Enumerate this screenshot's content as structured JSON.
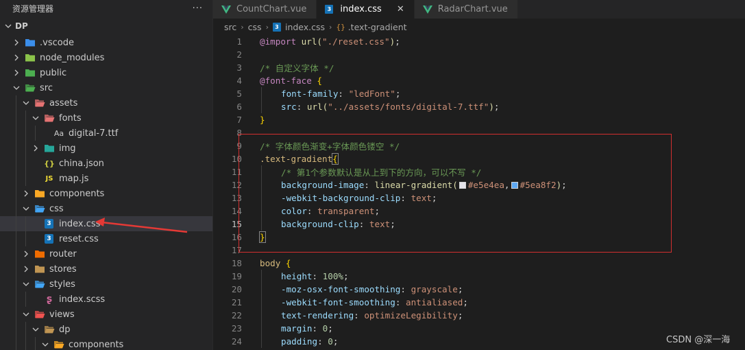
{
  "sidebar": {
    "title": "资源管理器",
    "more": "···",
    "root": "DP",
    "items": [
      {
        "label": ".vscode",
        "depth": 1,
        "kind": "folder",
        "icon": "vscode-folder-icon",
        "color": "#3b8eea",
        "open": false
      },
      {
        "label": "node_modules",
        "depth": 1,
        "kind": "folder",
        "icon": "node-folder-icon",
        "color": "#8bc34a",
        "open": false
      },
      {
        "label": "public",
        "depth": 1,
        "kind": "folder",
        "icon": "public-folder-icon",
        "color": "#4caf50",
        "open": false
      },
      {
        "label": "src",
        "depth": 1,
        "kind": "folder",
        "icon": "src-folder-icon",
        "color": "#4caf50",
        "open": true
      },
      {
        "label": "assets",
        "depth": 2,
        "kind": "folder",
        "icon": "assets-folder-icon",
        "color": "#e57373",
        "open": true
      },
      {
        "label": "fonts",
        "depth": 3,
        "kind": "folder",
        "icon": "fonts-folder-icon",
        "color": "#e57373",
        "open": true
      },
      {
        "label": "digital-7.ttf",
        "depth": 4,
        "kind": "font",
        "icon": "font-file-icon",
        "glyph": "Aa"
      },
      {
        "label": "img",
        "depth": 3,
        "kind": "folder",
        "icon": "img-folder-icon",
        "color": "#26a69a",
        "open": false
      },
      {
        "label": "china.json",
        "depth": 3,
        "kind": "json",
        "icon": "json-file-icon",
        "glyph": "{}"
      },
      {
        "label": "map.js",
        "depth": 3,
        "kind": "js",
        "icon": "js-file-icon",
        "glyph": "JS"
      },
      {
        "label": "components",
        "depth": 2,
        "kind": "folder",
        "icon": "components-folder-icon",
        "color": "#f9a825",
        "open": false
      },
      {
        "label": "css",
        "depth": 2,
        "kind": "folder",
        "icon": "css-folder-icon",
        "color": "#42a5f5",
        "open": true
      },
      {
        "label": "index.css",
        "depth": 3,
        "kind": "css",
        "icon": "css-file-icon",
        "glyph": "3",
        "selected": true
      },
      {
        "label": "reset.css",
        "depth": 3,
        "kind": "css",
        "icon": "css-file-icon",
        "glyph": "3"
      },
      {
        "label": "router",
        "depth": 2,
        "kind": "folder",
        "icon": "router-folder-icon",
        "color": "#ef6c00",
        "open": false
      },
      {
        "label": "stores",
        "depth": 2,
        "kind": "folder",
        "icon": "stores-folder-icon",
        "color": "#c09553",
        "open": false
      },
      {
        "label": "styles",
        "depth": 2,
        "kind": "folder",
        "icon": "styles-folder-icon",
        "color": "#42a5f5",
        "open": true
      },
      {
        "label": "index.scss",
        "depth": 3,
        "kind": "scss",
        "icon": "scss-file-icon",
        "glyph": "ʂ"
      },
      {
        "label": "views",
        "depth": 2,
        "kind": "folder",
        "icon": "views-folder-icon",
        "color": "#ef5350",
        "open": true
      },
      {
        "label": "dp",
        "depth": 3,
        "kind": "folder",
        "icon": "dp-folder-icon",
        "color": "#c09553",
        "open": true
      },
      {
        "label": "components",
        "depth": 4,
        "kind": "folder",
        "icon": "components-folder-icon",
        "color": "#f9a825",
        "open": true
      }
    ]
  },
  "tabs": [
    {
      "label": "CountChart.vue",
      "kind": "vue",
      "active": false
    },
    {
      "label": "index.css",
      "kind": "css",
      "active": true,
      "close": "✕"
    },
    {
      "label": "RadarChart.vue",
      "kind": "vue",
      "active": false
    }
  ],
  "breadcrumb": {
    "parts": [
      "src",
      "css",
      "index.css",
      ".text-gradient"
    ],
    "sep": "›",
    "css_glyph": "3",
    "symbol_glyph": "{}"
  },
  "editor": {
    "current_line": 15,
    "lines": [
      {
        "n": "1",
        "tokens": [
          [
            "at",
            "@import "
          ],
          [
            "fn",
            "url("
          ],
          [
            "str",
            "\"./reset.css\""
          ],
          [
            "fn",
            ")"
          ],
          [
            "pun",
            ";"
          ]
        ]
      },
      {
        "n": "2",
        "tokens": []
      },
      {
        "n": "3",
        "tokens": [
          [
            "cmt",
            "/* 自定义字体 */"
          ]
        ]
      },
      {
        "n": "4",
        "tokens": [
          [
            "at",
            "@font-face "
          ],
          [
            "brace",
            "{"
          ]
        ]
      },
      {
        "n": "5",
        "indent": 1,
        "tokens": [
          [
            "prop",
            "font-family"
          ],
          [
            "pun",
            ": "
          ],
          [
            "str",
            "\"ledFont\""
          ],
          [
            "pun",
            ";"
          ]
        ]
      },
      {
        "n": "6",
        "indent": 1,
        "tokens": [
          [
            "prop",
            "src"
          ],
          [
            "pun",
            ": "
          ],
          [
            "fn",
            "url("
          ],
          [
            "str",
            "\"../assets/fonts/digital-7.ttf\""
          ],
          [
            "fn",
            ")"
          ],
          [
            "pun",
            ";"
          ]
        ]
      },
      {
        "n": "7",
        "tokens": [
          [
            "brace",
            "}"
          ]
        ]
      },
      {
        "n": "8",
        "tokens": []
      },
      {
        "n": "9",
        "tokens": [
          [
            "cmt",
            "/* 字体颜色渐变+字体颜色镂空 */"
          ]
        ]
      },
      {
        "n": "10",
        "tokens": [
          [
            "sel",
            ".text-gradient"
          ],
          [
            "brace",
            "{"
          ]
        ]
      },
      {
        "n": "11",
        "indent": 1,
        "tokens": [
          [
            "cmt",
            "/* 第1个参数默认是从上到下的方向，可以不写 */"
          ]
        ]
      },
      {
        "n": "12",
        "indent": 1,
        "tokens": [
          [
            "prop",
            "background-image"
          ],
          [
            "pun",
            ": "
          ],
          [
            "fn",
            "linear-gradient("
          ],
          [
            "swatch",
            "#e5e4ea"
          ],
          [
            "val",
            "#e5e4ea"
          ],
          [
            "pun",
            ","
          ],
          [
            "swatch",
            "#5ea8f2"
          ],
          [
            "val",
            "#5ea8f2"
          ],
          [
            "fn",
            ")"
          ],
          [
            "pun",
            ";"
          ]
        ]
      },
      {
        "n": "13",
        "indent": 1,
        "tokens": [
          [
            "prop",
            "-webkit-background-clip"
          ],
          [
            "pun",
            ": "
          ],
          [
            "val",
            "text"
          ],
          [
            "pun",
            ";"
          ]
        ]
      },
      {
        "n": "14",
        "indent": 1,
        "tokens": [
          [
            "prop",
            "color"
          ],
          [
            "pun",
            ": "
          ],
          [
            "val",
            "transparent"
          ],
          [
            "pun",
            ";"
          ]
        ]
      },
      {
        "n": "15",
        "indent": 1,
        "tokens": [
          [
            "prop",
            "background-clip"
          ],
          [
            "pun",
            ": "
          ],
          [
            "val",
            "text"
          ],
          [
            "pun",
            ";"
          ]
        ]
      },
      {
        "n": "16",
        "tokens": [
          [
            "brace",
            "}"
          ]
        ]
      },
      {
        "n": "17",
        "tokens": []
      },
      {
        "n": "18",
        "tokens": [
          [
            "sel",
            "body "
          ],
          [
            "brace",
            "{"
          ]
        ]
      },
      {
        "n": "19",
        "indent": 1,
        "tokens": [
          [
            "prop",
            "height"
          ],
          [
            "pun",
            ": "
          ],
          [
            "num",
            "100%"
          ],
          [
            "pun",
            ";"
          ]
        ]
      },
      {
        "n": "20",
        "indent": 1,
        "tokens": [
          [
            "prop",
            "-moz-osx-font-smoothing"
          ],
          [
            "pun",
            ": "
          ],
          [
            "val",
            "grayscale"
          ],
          [
            "pun",
            ";"
          ]
        ]
      },
      {
        "n": "21",
        "indent": 1,
        "tokens": [
          [
            "prop",
            "-webkit-font-smoothing"
          ],
          [
            "pun",
            ": "
          ],
          [
            "val",
            "antialiased"
          ],
          [
            "pun",
            ";"
          ]
        ]
      },
      {
        "n": "22",
        "indent": 1,
        "tokens": [
          [
            "prop",
            "text-rendering"
          ],
          [
            "pun",
            ": "
          ],
          [
            "val",
            "optimizeLegibility"
          ],
          [
            "pun",
            ";"
          ]
        ]
      },
      {
        "n": "23",
        "indent": 1,
        "tokens": [
          [
            "prop",
            "margin"
          ],
          [
            "pun",
            ": "
          ],
          [
            "num",
            "0"
          ],
          [
            "pun",
            ";"
          ]
        ]
      },
      {
        "n": "24",
        "indent": 1,
        "tokens": [
          [
            "prop",
            "padding"
          ],
          [
            "pun",
            ": "
          ],
          [
            "num",
            "0"
          ],
          [
            "pun",
            ";"
          ]
        ]
      }
    ]
  },
  "watermark": "CSDN @深一海",
  "colors": {
    "accent": "#1572b6",
    "highlight_box": "#d32f2f",
    "arrow": "#e53935",
    "vue": "#41b883"
  }
}
